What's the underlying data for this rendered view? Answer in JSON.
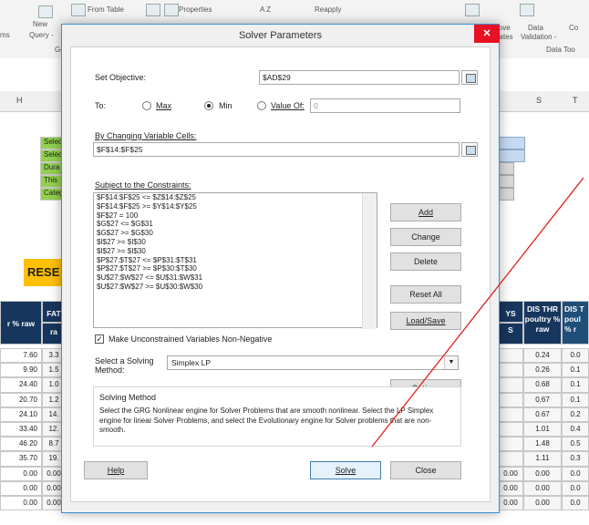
{
  "ribbon": {
    "new_query_label": "New",
    "new_query_sub": "Query -",
    "get_label": "Ge",
    "left_edge": "ms",
    "from_table": "From Table",
    "properties": "Properties",
    "az": "A Z",
    "reapply": "Reapply",
    "data_label": "Data",
    "validation_label": "Validation -",
    "remove_label": "move",
    "duplicates_label": "licates",
    "co_label": "Co",
    "data_tools_label": "Data Too"
  },
  "columns": {
    "h": "H",
    "s": "S",
    "t": "T"
  },
  "sheet": {
    "left_labels": [
      "Selec",
      "Selec",
      "Dura",
      "This",
      "Categ"
    ],
    "banner": "RESE",
    "hdr_raw": "r % raw",
    "hdr_fat": "FAT",
    "hdr_fat2": "ra",
    "hdr_ys": "YS",
    "hdr_ys2": "S",
    "hdr_dis_thr": "DIS THR poultry % raw",
    "hdr_dis_t": "DIS T poul % r",
    "col_a": [
      "7.60",
      "9.90",
      "24.40",
      "20.70",
      "24.10",
      "33.40",
      "46.20",
      "35.70",
      "0.00",
      "0.00",
      "0.00"
    ],
    "col_b": [
      "3.3",
      "1.5",
      "1.0",
      "1.2",
      "14.",
      "12.",
      "8.7",
      "19.",
      "0.00",
      "0.00",
      "0.00"
    ],
    "col_s": [
      "0.24",
      "0.26",
      "0.68",
      "0.67",
      "0.67",
      "1.01",
      "1.48",
      "1.11",
      "0.00",
      "0.00",
      "0.00"
    ],
    "col_t": [
      "0.0",
      "0.1",
      "0.1",
      "0.1",
      "0.2",
      "0.4",
      "0.5",
      "0.3",
      "0.0",
      "0.0",
      "0.0"
    ],
    "zero": "0.00"
  },
  "dialog": {
    "title": "Solver Parameters",
    "close_glyph": "✕",
    "set_objective_label": "Set Objective:",
    "set_objective_value": "$AD$29",
    "to_label": "To:",
    "max_label": "Max",
    "min_label": "Min",
    "value_of_label": "Value Of:",
    "value_of_value": "0",
    "selected_goal": "Min",
    "changing_cells_label": "By Changing Variable Cells:",
    "changing_cells_value": "$F$14:$F$25",
    "constraints_label": "Subject to the Constraints:",
    "constraints": [
      "$F$14:$F$25 <= $Z$14:$Z$25",
      "$F$14:$F$25 >= $Y$14:$Y$25",
      "$F$27 = 100",
      "$G$27 <= $G$31",
      "$G$27 >= $G$30",
      "$I$27 >= $I$30",
      "$I$27 >= $I$30",
      "$P$27:$T$27 <= $P$31:$T$31",
      "$P$27:$T$27 >= $P$30:$T$30",
      "$U$27:$W$27 <= $U$31:$W$31",
      "$U$27:$W$27 >= $U$30:$W$30"
    ],
    "add_button": "Add",
    "change_button": "Change",
    "delete_button": "Delete",
    "reset_all_button": "Reset All",
    "load_save_button": "Load/Save",
    "nonneg_label": "Make Unconstrained Variables Non-Negative",
    "nonneg_checked": "✓",
    "method_label_1": "Select a Solving",
    "method_label_2": "Method:",
    "method_value": "Simplex LP",
    "options_button": "Options",
    "solving_method_heading": "Solving Method",
    "solving_method_text": "Select the GRG Nonlinear engine for Solver Problems that are smooth nonlinear. Select the LP Simplex engine for linear Solver Problems, and select the Evolutionary engine for Solver problems that are non-smooth.",
    "help_button": "Help",
    "solve_button": "Solve",
    "close_button": "Close",
    "annotation_color": "#e02020"
  }
}
